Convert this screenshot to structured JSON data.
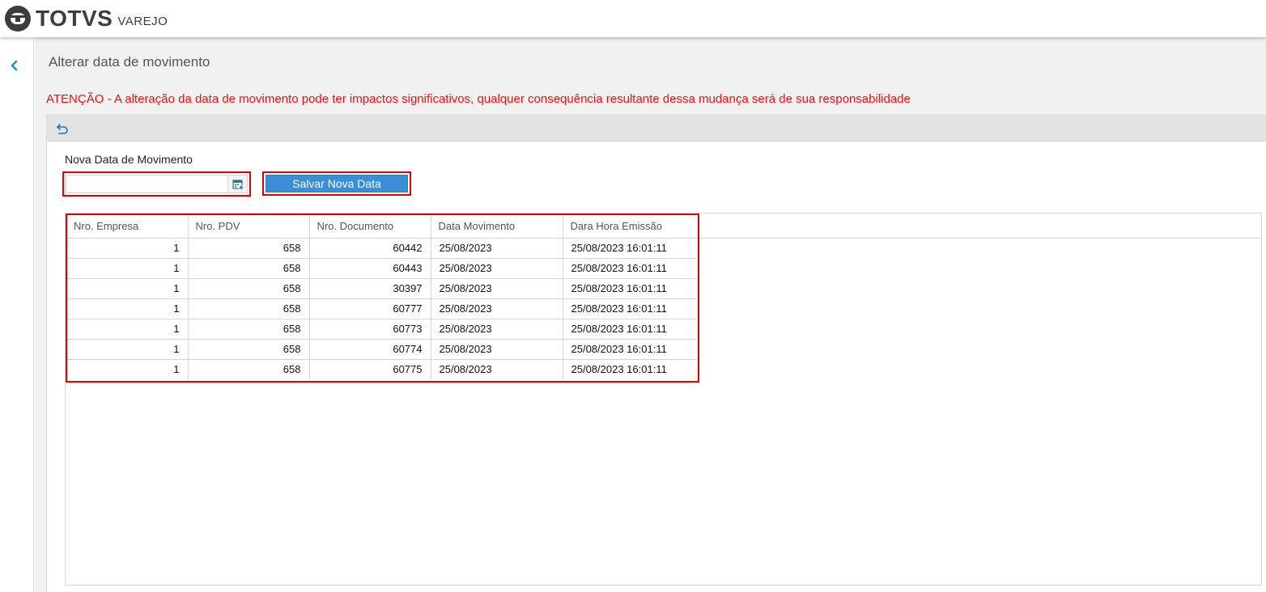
{
  "brand": {
    "name": "TOTVS",
    "product": "VAREJO"
  },
  "page": {
    "title": "Alterar data de movimento",
    "warning": "ATENÇÃO - A alteração da data de movimento pode ter impactos significativos, qualquer consequência resultante dessa mudança será de sua responsabilidade"
  },
  "form": {
    "date_label": "Nova Data de Movimento",
    "date_value": "",
    "save_label": "Salvar Nova Data"
  },
  "icons": {
    "back": "chevron-left-icon",
    "undo": "undo-icon",
    "calendar": "calendar-icon"
  },
  "colors": {
    "accent": "#3a8ed6",
    "warning": "#ee1111",
    "highlight": "#e20000",
    "back_arrow": "#1e90d8"
  },
  "grid": {
    "columns": [
      "Nro. Empresa",
      "Nro. PDV",
      "Nro. Documento",
      "Data Movimento",
      "Dara Hora Emissão"
    ],
    "rows": [
      [
        "1",
        "658",
        "60442",
        "25/08/2023",
        "25/08/2023 16:01:11"
      ],
      [
        "1",
        "658",
        "60443",
        "25/08/2023",
        "25/08/2023 16:01:11"
      ],
      [
        "1",
        "658",
        "30397",
        "25/08/2023",
        "25/08/2023 16:01:11"
      ],
      [
        "1",
        "658",
        "60777",
        "25/08/2023",
        "25/08/2023 16:01:11"
      ],
      [
        "1",
        "658",
        "60773",
        "25/08/2023",
        "25/08/2023 16:01:11"
      ],
      [
        "1",
        "658",
        "60774",
        "25/08/2023",
        "25/08/2023 16:01:11"
      ],
      [
        "1",
        "658",
        "60775",
        "25/08/2023",
        "25/08/2023 16:01:11"
      ]
    ]
  }
}
